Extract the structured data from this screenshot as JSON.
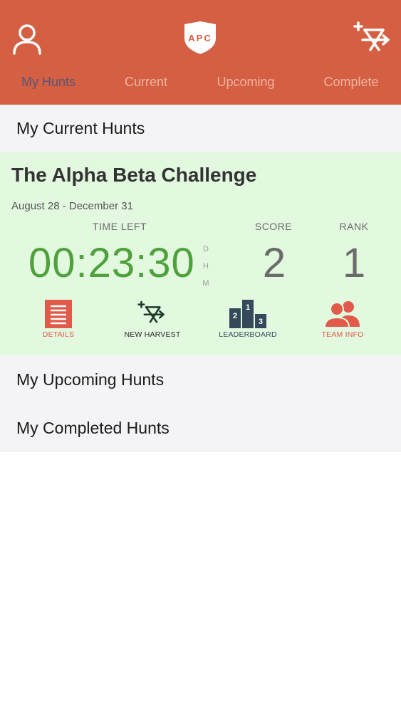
{
  "header": {
    "logo_text": "APC",
    "tabs": [
      {
        "label": "My Hunts",
        "active": true
      },
      {
        "label": "Current",
        "active": false
      },
      {
        "label": "Upcoming",
        "active": false
      },
      {
        "label": "Complete",
        "active": false
      }
    ]
  },
  "sections": {
    "current": "My Current Hunts",
    "upcoming": "My Upcoming Hunts",
    "completed": "My Completed Hunts"
  },
  "hunt": {
    "title": "The Alpha Beta Challenge",
    "dates": "August 28 - December 31",
    "time_left_label": "TIME LEFT",
    "time_left": "00:23:30",
    "units": [
      "D",
      "H",
      "M"
    ],
    "score_label": "SCORE",
    "score": "2",
    "rank_label": "RANK",
    "rank": "1",
    "actions": {
      "details": "DETAILS",
      "new_harvest": "NEW HARVEST",
      "leaderboard": "LEADERBOARD",
      "team_info": "TEAM INFO"
    },
    "podium": [
      "2",
      "1",
      "3"
    ]
  },
  "colors": {
    "header": "#d45f43",
    "active_tab": "#5b5578",
    "inactive_tab": "#f0b3a1",
    "card_bg": "#e2f8df",
    "timer": "#4fa13c",
    "accent_red": "#e15a4a",
    "dark_slate": "#34495a"
  },
  "icons": [
    "person-icon",
    "shield-logo-icon",
    "harvest-arrow-icon",
    "details-icon",
    "leaderboard-icon",
    "team-icon"
  ]
}
